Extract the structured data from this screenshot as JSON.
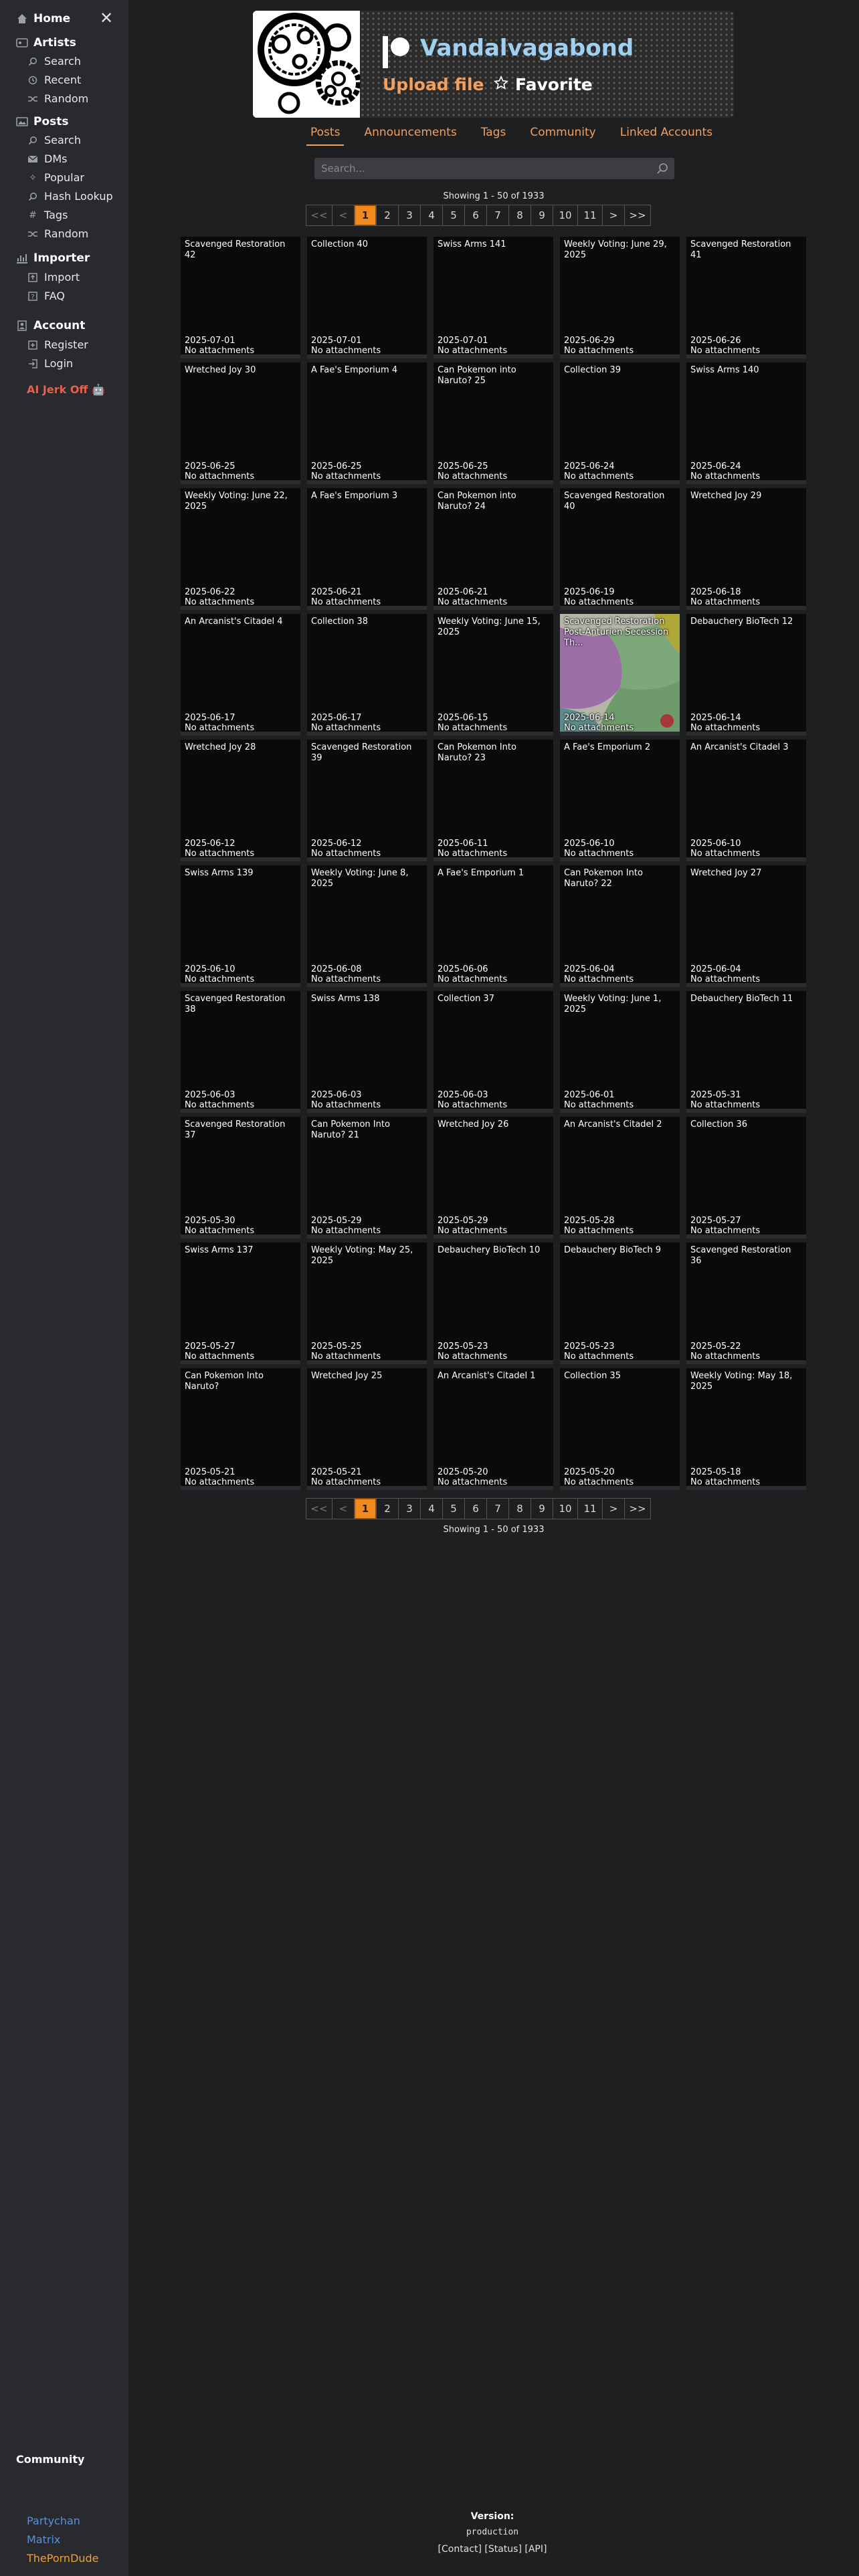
{
  "sidebar": {
    "home": "Home",
    "artists": {
      "label": "Artists",
      "items": [
        "Search",
        "Recent",
        "Random"
      ]
    },
    "posts": {
      "label": "Posts",
      "items": [
        "Search",
        "DMs",
        "Popular",
        "Hash Lookup",
        "Tags",
        "Random"
      ]
    },
    "importer": {
      "label": "Importer",
      "items": [
        "Import",
        "FAQ"
      ]
    },
    "account": {
      "label": "Account",
      "items": [
        "Register",
        "Login"
      ]
    },
    "ai_jerk": "AI Jerk Off 🤖",
    "community": {
      "label": "Community",
      "links": [
        "Partychan",
        "Matrix",
        "ThePornDude"
      ]
    }
  },
  "header": {
    "creator_name": "Vandalvagabond",
    "upload_label": "Upload file",
    "favorite_label": "Favorite"
  },
  "tabs": [
    "Posts",
    "Announcements",
    "Tags",
    "Community",
    "Linked Accounts"
  ],
  "search": {
    "placeholder": "Search..."
  },
  "showing": "Showing 1 - 50 of 1933",
  "pager": [
    "<<",
    "<",
    "1",
    "2",
    "3",
    "4",
    "5",
    "6",
    "7",
    "8",
    "9",
    "10",
    "11",
    ">",
    ">>"
  ],
  "no_attach": "No attachments",
  "posts": [
    {
      "title": "Scavenged Restoration 42",
      "date": "2025-07-01"
    },
    {
      "title": "Collection 40",
      "date": "2025-07-01"
    },
    {
      "title": "Swiss Arms 141",
      "date": "2025-07-01"
    },
    {
      "title": "Weekly Voting: June 29, 2025",
      "date": "2025-06-29"
    },
    {
      "title": "Scavenged Restoration 41",
      "date": "2025-06-26"
    },
    {
      "title": "Wretched Joy 30",
      "date": "2025-06-25"
    },
    {
      "title": "A Fae's Emporium 4",
      "date": "2025-06-25"
    },
    {
      "title": "Can Pokemon into Naruto? 25",
      "date": "2025-06-25"
    },
    {
      "title": "Collection 39",
      "date": "2025-06-24"
    },
    {
      "title": "Swiss Arms 140",
      "date": "2025-06-24"
    },
    {
      "title": "Weekly Voting: June 22, 2025",
      "date": "2025-06-22"
    },
    {
      "title": "A Fae's Emporium 3",
      "date": "2025-06-21"
    },
    {
      "title": "Can Pokemon into Naruto? 24",
      "date": "2025-06-21"
    },
    {
      "title": "Scavenged Restoration 40",
      "date": "2025-06-19"
    },
    {
      "title": "Wretched Joy 29",
      "date": "2025-06-18"
    },
    {
      "title": "An Arcanist's Citadel 4",
      "date": "2025-06-17"
    },
    {
      "title": "Collection 38",
      "date": "2025-06-17"
    },
    {
      "title": "Weekly Voting: June 15, 2025",
      "date": "2025-06-15"
    },
    {
      "title": "Scavenged Restoration Post-Anturien Secession Th...",
      "date": "2025-06-14",
      "thumb": true
    },
    {
      "title": "Debauchery BioTech 12",
      "date": "2025-06-14"
    },
    {
      "title": "Wretched Joy 28",
      "date": "2025-06-12"
    },
    {
      "title": "Scavenged Restoration 39",
      "date": "2025-06-12"
    },
    {
      "title": "Can Pokemon Into Naruto? 23",
      "date": "2025-06-11"
    },
    {
      "title": "A Fae's Emporium 2",
      "date": "2025-06-10"
    },
    {
      "title": "An Arcanist's Citadel 3",
      "date": "2025-06-10"
    },
    {
      "title": "Swiss Arms 139",
      "date": "2025-06-10"
    },
    {
      "title": "Weekly Voting: June 8, 2025",
      "date": "2025-06-08"
    },
    {
      "title": "A Fae's Emporium 1",
      "date": "2025-06-06"
    },
    {
      "title": "Can Pokemon Into Naruto? 22",
      "date": "2025-06-04"
    },
    {
      "title": "Wretched Joy 27",
      "date": "2025-06-04"
    },
    {
      "title": "Scavenged Restoration 38",
      "date": "2025-06-03"
    },
    {
      "title": "Swiss Arms 138",
      "date": "2025-06-03"
    },
    {
      "title": "Collection 37",
      "date": "2025-06-03"
    },
    {
      "title": "Weekly Voting: June 1, 2025",
      "date": "2025-06-01"
    },
    {
      "title": "Debauchery BioTech 11",
      "date": "2025-05-31"
    },
    {
      "title": "Scavenged Restoration 37",
      "date": "2025-05-30"
    },
    {
      "title": "Can Pokemon Into Naruto? 21",
      "date": "2025-05-29"
    },
    {
      "title": "Wretched Joy 26",
      "date": "2025-05-29"
    },
    {
      "title": "An Arcanist's Citadel 2",
      "date": "2025-05-28"
    },
    {
      "title": "Collection 36",
      "date": "2025-05-27"
    },
    {
      "title": "Swiss Arms 137",
      "date": "2025-05-27"
    },
    {
      "title": "Weekly Voting: May 25, 2025",
      "date": "2025-05-25"
    },
    {
      "title": "Debauchery BioTech 10",
      "date": "2025-05-23"
    },
    {
      "title": "Debauchery BioTech 9",
      "date": "2025-05-23"
    },
    {
      "title": "Scavenged Restoration 36",
      "date": "2025-05-22"
    },
    {
      "title": "Can Pokemon Into Naruto?",
      "date": "2025-05-21"
    },
    {
      "title": "Wretched Joy 25",
      "date": "2025-05-21"
    },
    {
      "title": "An Arcanist's Citadel 1",
      "date": "2025-05-20"
    },
    {
      "title": "Collection 35",
      "date": "2025-05-20"
    },
    {
      "title": "Weekly Voting: May 18, 2025",
      "date": "2025-05-18"
    }
  ],
  "footer": {
    "version_label": "Version:",
    "version_value": "production",
    "links": "[Contact]  [Status]  [API]"
  },
  "colors": {
    "accent": "#f0a060",
    "current_page": "#f08a1c",
    "creator_name": "#9fd0ef",
    "ai_jerk": "#e5604f"
  }
}
